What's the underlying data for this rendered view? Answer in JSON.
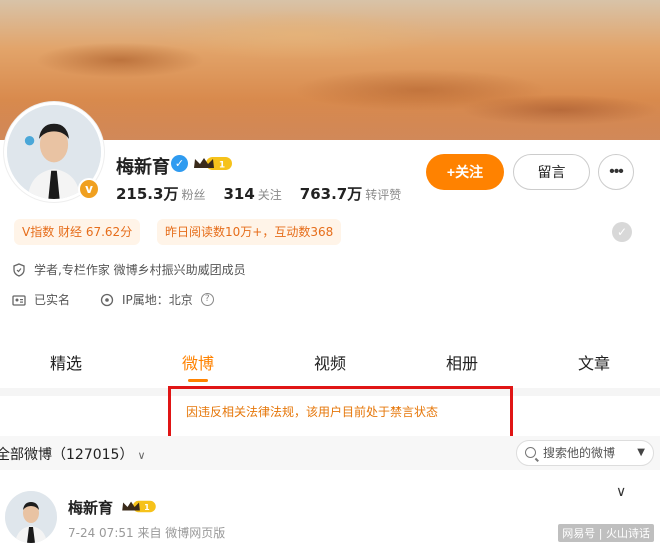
{
  "profile": {
    "name": "梅新育",
    "avatar_badge": "v",
    "crown_level": "1",
    "stats": [
      {
        "value": "215.3万",
        "label": "粉丝"
      },
      {
        "value": "314",
        "label": "关注"
      },
      {
        "value": "763.7万",
        "label": "转评赞"
      }
    ],
    "follow_label": "+关注",
    "message_label": "留言",
    "more_label": "•••",
    "tags": [
      "V指数 财经 67.62分",
      "昨日阅读数10万+，互动数368"
    ],
    "bio": "学者,专栏作家 微博乡村振兴助威团成员",
    "real_name": "已实名",
    "ip_location": "IP属地：北京",
    "help_symbol": "?"
  },
  "tabs": [
    {
      "label": "精选"
    },
    {
      "label": "微博"
    },
    {
      "label": "视频"
    },
    {
      "label": "相册"
    },
    {
      "label": "文章"
    }
  ],
  "ban_notice": "因违反相关法律法规，该用户目前处于禁言状态",
  "feed": {
    "all_posts_label": "全部微博（127015）",
    "search_placeholder": "搜索他的微博"
  },
  "post": {
    "author": "梅新育",
    "time_source": "7-24 07:51  来自 微博网页版"
  },
  "watermark": "网易号 | 火山诗话",
  "colors": {
    "accent": "#ff8200",
    "ban_border": "#e01515",
    "ban_text": "#e6770a",
    "verified": "#2f9bf0"
  },
  "icons": {
    "verified": "verified-icon",
    "crown": "crown-icon",
    "check": "check-icon",
    "shield": "shield-icon",
    "id_card": "id-card-icon",
    "location": "location-icon",
    "search": "search-icon"
  }
}
